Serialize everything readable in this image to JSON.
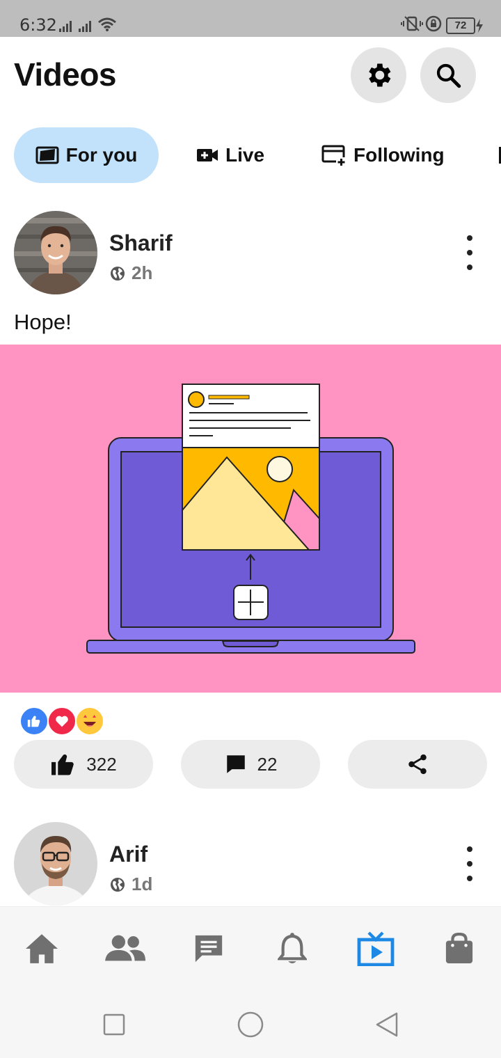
{
  "status_bar": {
    "time": "6:32",
    "battery": "72"
  },
  "header": {
    "title": "Videos",
    "settings_icon": "gear-icon",
    "search_icon": "search-icon"
  },
  "tabs": [
    {
      "label": "For you",
      "icon": "for-you-icon",
      "active": true
    },
    {
      "label": "Live",
      "icon": "live-camera-icon",
      "active": false
    },
    {
      "label": "Following",
      "icon": "following-icon",
      "active": false
    }
  ],
  "posts": [
    {
      "author": "Sharif",
      "time": "2h",
      "privacy_icon": "globe-icon",
      "text": "Hope!",
      "reactions": [
        "like-reaction-icon",
        "love-reaction-icon",
        "wow-reaction-icon"
      ],
      "likes": "322",
      "comments": "22"
    },
    {
      "author": "Arif",
      "time": "1d",
      "privacy_icon": "globe-icon"
    }
  ],
  "bottom_nav": [
    "home-icon",
    "friends-icon",
    "messages-icon",
    "notifications-icon",
    "videos-icon",
    "marketplace-icon"
  ],
  "bottom_nav_active": "videos-icon",
  "colors": {
    "accent": "#1e88e5",
    "active_tab_bg": "#c2e1fb",
    "media_bg": "#ff94c2",
    "laptop": "#8b79f0",
    "laptop_screen": "#6f5bd6"
  }
}
